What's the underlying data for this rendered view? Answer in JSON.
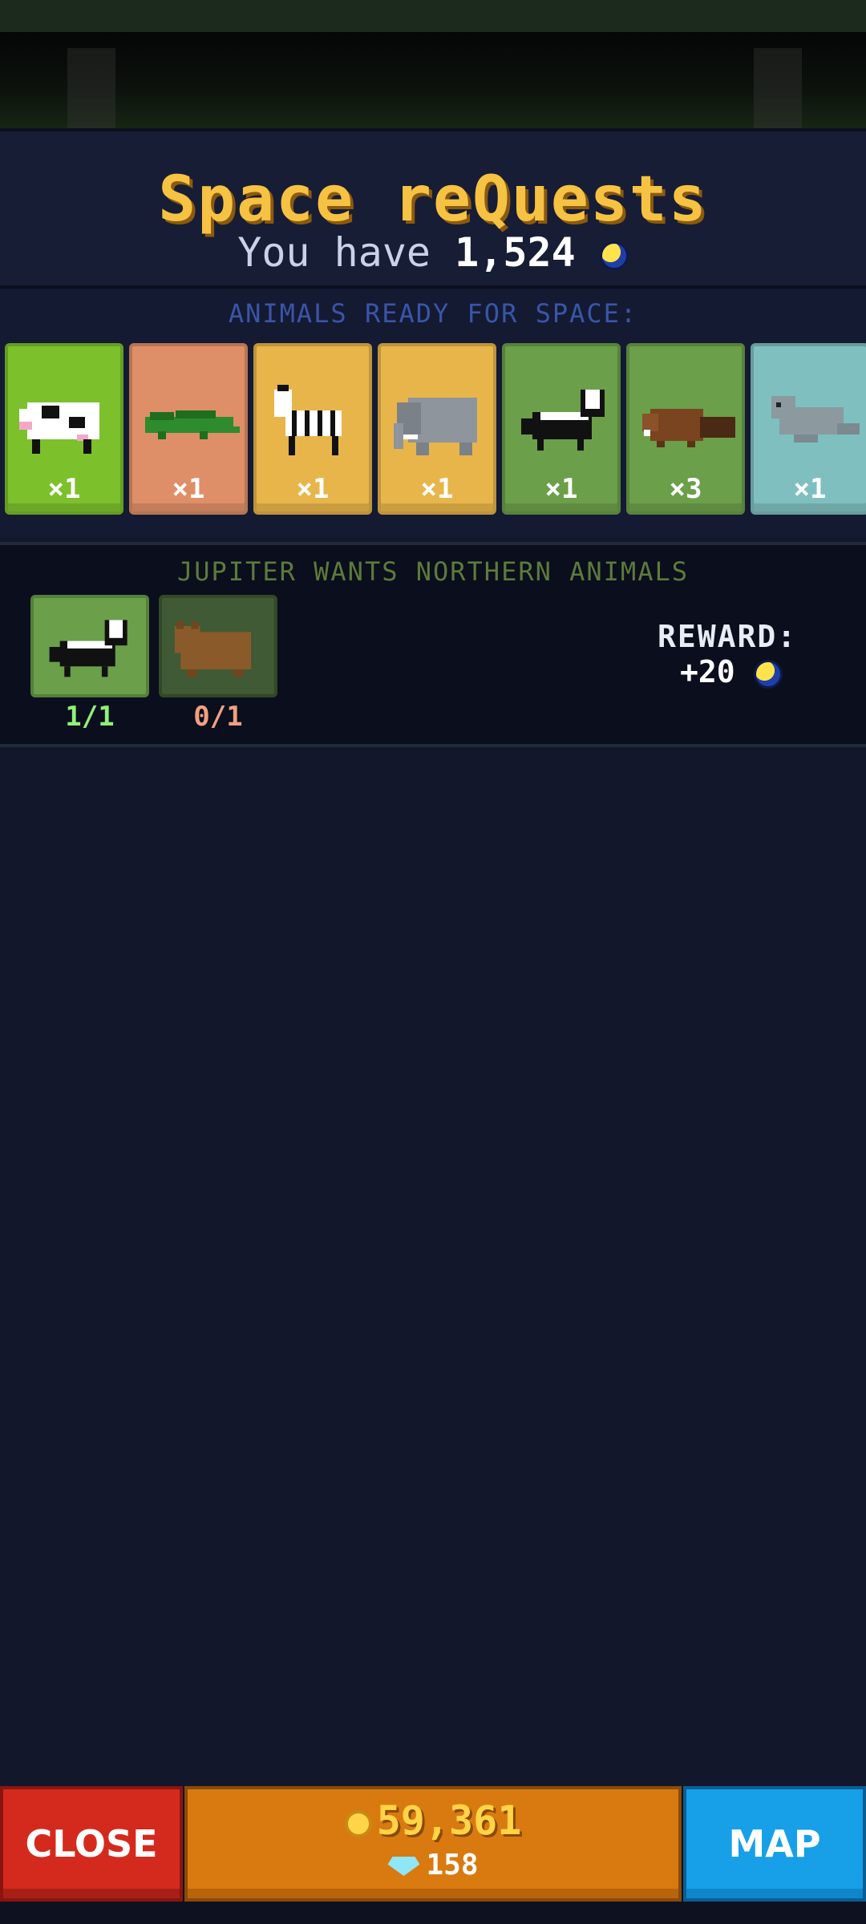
{
  "header": {
    "title": "Space reQuests",
    "you_have_prefix": "You have",
    "balance": "1,524",
    "currency_icon": "moon-coin-icon"
  },
  "ready": {
    "label": "ANIMALS READY FOR SPACE:",
    "animals": [
      {
        "animal": "cow",
        "count": "×1",
        "color": "#7cc02c"
      },
      {
        "animal": "crocodile",
        "count": "×1",
        "color": "#de8f67"
      },
      {
        "animal": "zebra",
        "count": "×1",
        "color": "#e8b54a"
      },
      {
        "animal": "elephant",
        "count": "×1",
        "color": "#e8b54a"
      },
      {
        "animal": "skunk",
        "count": "×1",
        "color": "#6b9f4a"
      },
      {
        "animal": "beaver",
        "count": "×3",
        "color": "#6b9f4a"
      },
      {
        "animal": "seal",
        "count": "×1",
        "color": "#7fbfbf"
      }
    ]
  },
  "quest": {
    "label": "JUPITER WANTS NORTHERN ANIMALS",
    "slots": [
      {
        "animal": "skunk",
        "progress": "1/1",
        "color": "#6b9f4a",
        "progress_color": "#8ff07a"
      },
      {
        "animal": "bear",
        "progress": "0/1",
        "color": "#3f5a34",
        "progress_color": "#f0a080"
      }
    ],
    "reward_label": "REWARD:",
    "reward_value": "+20"
  },
  "footer": {
    "close_label": "CLOSE",
    "coins": "59,361",
    "gems": "158",
    "map_label": "MAP"
  }
}
